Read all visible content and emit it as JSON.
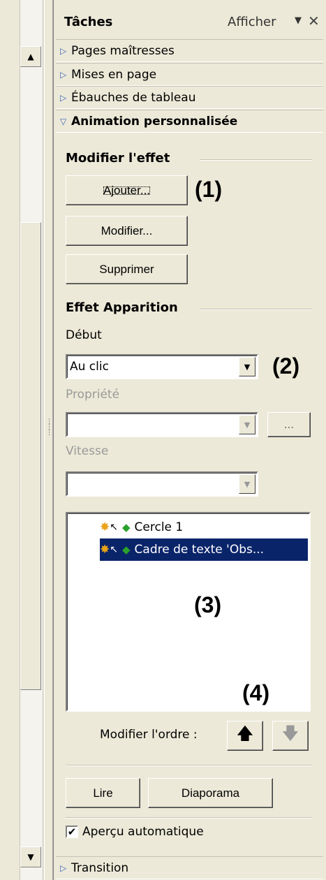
{
  "taskpane": {
    "title": "Tâches",
    "show_label": "Afficher",
    "sections": [
      {
        "label": "Pages maîtresses"
      },
      {
        "label": "Mises en page"
      },
      {
        "label": "Ébauches de tableau"
      },
      {
        "label": "Animation personnalisée"
      }
    ],
    "bottom_section": {
      "label": "Transition"
    }
  },
  "modify_effect": {
    "heading": "Modifier l'effet",
    "add_button": "Ajouter...",
    "modify_button": "Modifier...",
    "delete_button": "Supprimer"
  },
  "effect": {
    "heading": "Effet Apparition",
    "start_label": "Début",
    "start_value": "Au clic",
    "property_label": "Propriété",
    "property_value": "",
    "property_button": "...",
    "speed_label": "Vitesse",
    "speed_value": ""
  },
  "animation_list": {
    "items": [
      {
        "label": "Cercle 1",
        "selected": false
      },
      {
        "label": "Cadre de texte 'Obs...",
        "selected": true
      }
    ]
  },
  "order": {
    "label": "Modifier l'ordre :"
  },
  "actions": {
    "play_button": "Lire",
    "slideshow_button": "Diaporama"
  },
  "autopreview": {
    "label": "Aperçu automatique",
    "checked": true
  },
  "annotations": {
    "a1": "(1)",
    "a2": "(2)",
    "a3": "(3)",
    "a4": "(4)"
  },
  "colors": {
    "selection": "#0a246a",
    "triangle": "#3a64b5",
    "panel_bg": "#ece9d8"
  }
}
